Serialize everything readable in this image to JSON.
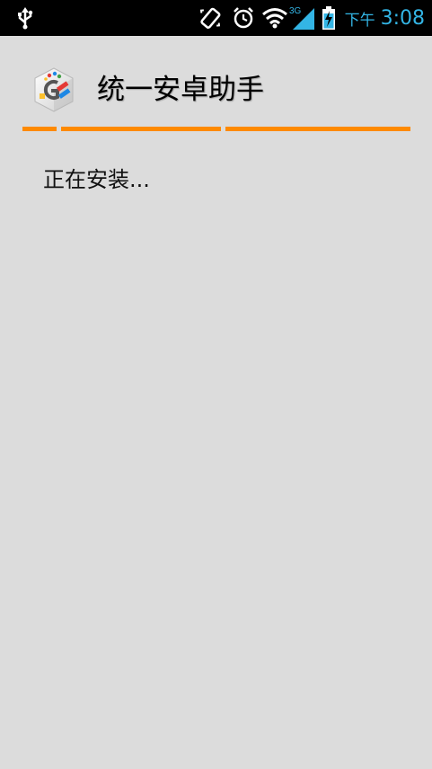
{
  "status_bar": {
    "ampm": "下午",
    "time": "3:08",
    "network": "3G",
    "icons": [
      "usb-icon",
      "vibrate-icon",
      "alarm-icon",
      "wifi-icon",
      "signal-icon",
      "battery-charging-icon"
    ],
    "accent_color": "#33b5e5"
  },
  "app": {
    "title": "统一安卓助手",
    "icon": "app-logo-icon",
    "divider_color": "#ff8a00"
  },
  "content": {
    "status_message": "正在安装..."
  }
}
